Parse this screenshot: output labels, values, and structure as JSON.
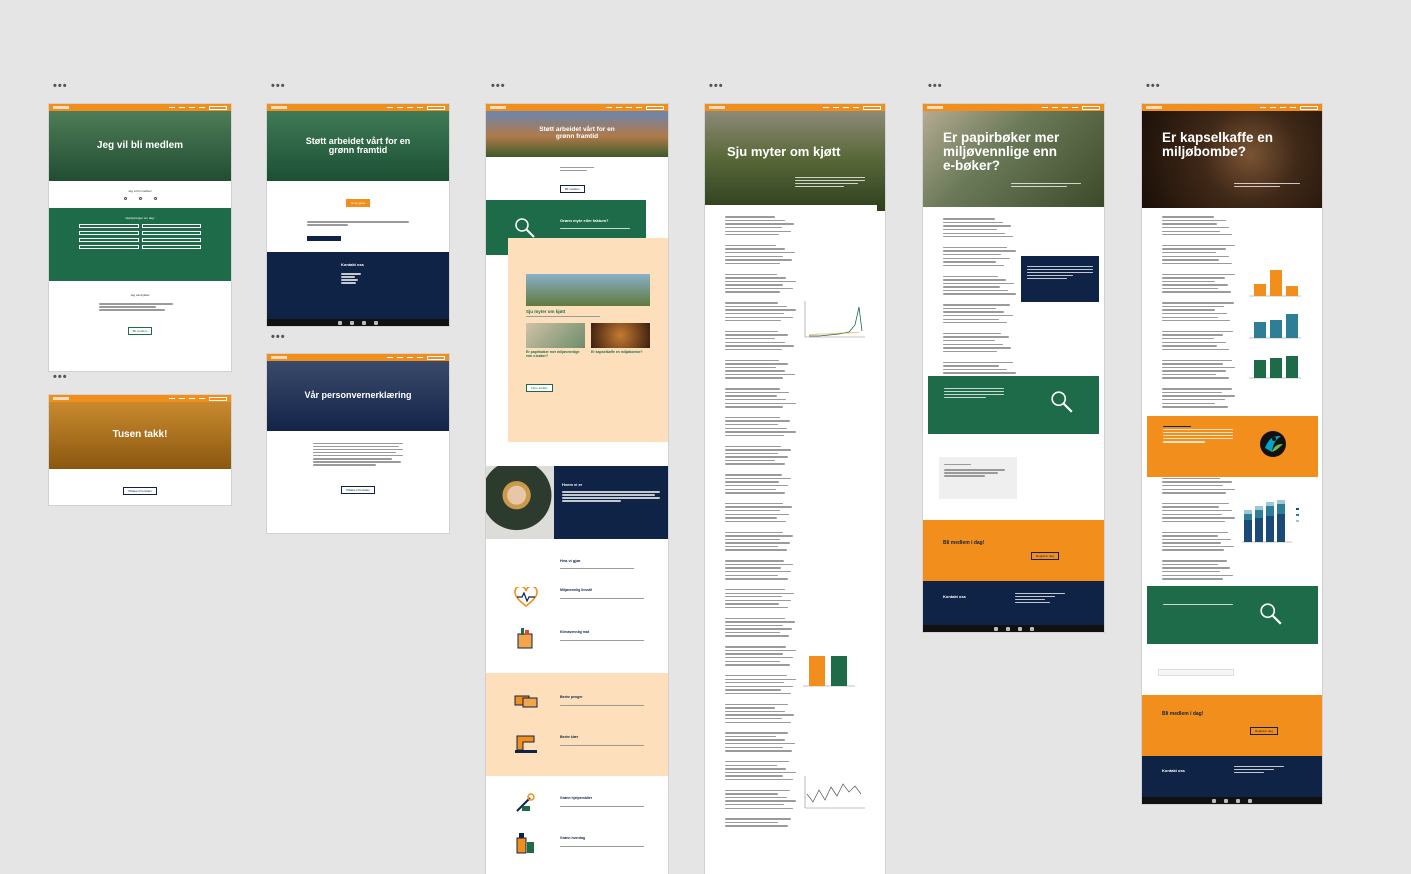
{
  "artboards": {
    "member": {
      "title": "Jeg vil bli medlem",
      "question": "Jeg vil bli medlem",
      "form_title": "Opplysninger om deg:",
      "submit": "Bli medlem",
      "consent": "Jeg samtykker"
    },
    "thanks": {
      "title": "Tusen takk!",
      "button": "Tilbake til forsiden"
    },
    "support": {
      "title": "Støtt arbeidet vårt for en grønn framtid",
      "button": "Gi en gave",
      "footer_title": "Kontakt oss"
    },
    "privacy": {
      "title": "Vår personvernerklæring",
      "button": "Tilbake til forsiden"
    },
    "home": {
      "hero_title": "Støtt arbeidet vårt for en grønn framtid",
      "hero_button": "Bli medlem",
      "myth_title": "Grønn myte eller faktum?",
      "card_main": "Sju myter om kjøtt",
      "card_a": "Er papirbøker mer miljøvennlige enn e-bøker?",
      "card_b": "Er kapselkaffe en miljøbombe?",
      "more_button": "Flere artikler",
      "who_title": "Hvem vi er",
      "what_title": "Hva vi gjør",
      "sections": [
        "Miljøvennlig livsstil",
        "Klimavennlig mat",
        "Bedre penger",
        "Bedre klær",
        "Grønn hjelpemidler",
        "Grønn hverdag"
      ]
    },
    "meat": {
      "title": "Sju myter om kjøtt"
    },
    "books": {
      "title": "Er papirbøker mer miljøvennlige enn e-bøker?",
      "cta": "Bli medlem i dag!",
      "cta_button": "Registrer deg",
      "footer_title": "Kontakt oss"
    },
    "coffee": {
      "title": "Er kapselkaffe en miljøbombe?",
      "cta": "Bli medlem i dag!",
      "cta_button": "Registrer deg",
      "footer_title": "Kontakt oss"
    }
  },
  "colors": {
    "orange": "#f28e1c",
    "green": "#1d6b49",
    "navy": "#0e2346",
    "peach": "#fde0bb",
    "canvas": "#e5e5e5"
  },
  "icons": [
    "menu-dots-icon",
    "search-icon",
    "heart-pulse-icon",
    "grocery-bag-icon",
    "money-icon",
    "sewing-machine-icon",
    "tools-icon",
    "cleaning-icon",
    "fairtrade-icon"
  ]
}
